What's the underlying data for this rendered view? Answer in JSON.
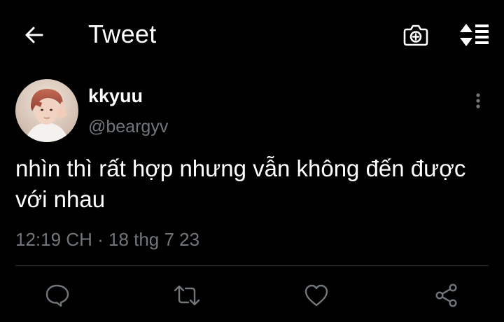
{
  "header": {
    "title": "Tweet",
    "back_icon": "arrow-left-icon",
    "camera_icon": "camera-icon",
    "sort_icon": "sort-lines-icon"
  },
  "tweet": {
    "author": {
      "display_name": "kkyuu",
      "handle": "@beargyv"
    },
    "text": "nhìn thì rất hợp nhưng vẫn không đến được với nhau",
    "time": "12:19 CH",
    "separator": "·",
    "date": "18 thg 7 23",
    "more_icon": "more-vertical-icon"
  },
  "actions": [
    {
      "icon": "reply-icon"
    },
    {
      "icon": "retweet-icon"
    },
    {
      "icon": "like-heart-icon"
    },
    {
      "icon": "share-icon"
    }
  ],
  "colors": {
    "background": "#000000",
    "primary_text": "#ffffff",
    "secondary_text": "#71767b",
    "divider": "#2f3336"
  }
}
